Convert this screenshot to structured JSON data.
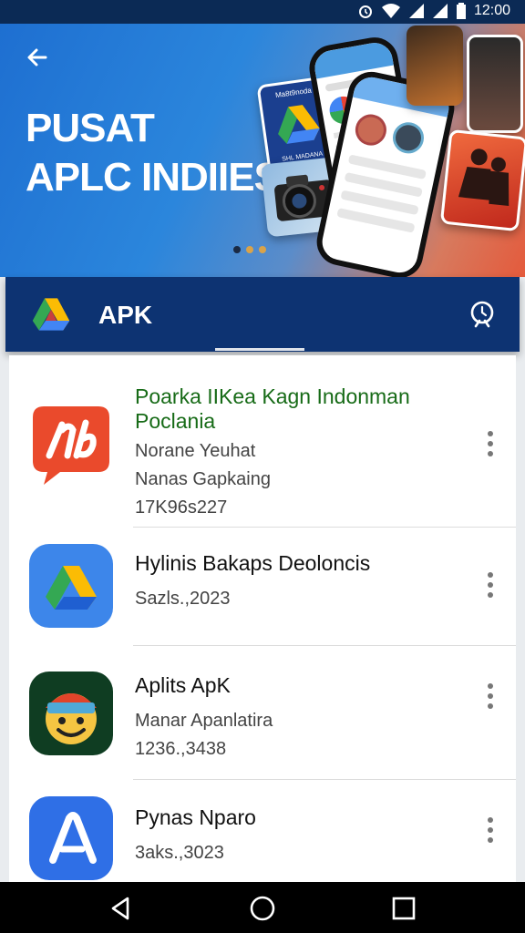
{
  "status_bar": {
    "time": "12:00"
  },
  "banner": {
    "title_line1": "PUSAT",
    "title_line2": "APLC INDIIESIA",
    "card_label": "Ma8t9noda",
    "card_sublabel": "SHL MADANA",
    "carousel_dots": 3,
    "carousel_active": 0
  },
  "appbar": {
    "title": "APK"
  },
  "apps": [
    {
      "name_line1": "Poarka IIKea Kagn Indonman",
      "name_line2": "Poclania",
      "detail1": "Norane Yeuhat",
      "detail2": "Nanas Gapkaing",
      "detail3": "17K96s227",
      "highlight": true
    },
    {
      "name_line1": "Hylinis Bakaps Deoloncis",
      "detail1": "Sazls.,2023"
    },
    {
      "name_line1": "Aplits ApK",
      "detail1": "Manar Apanlatira",
      "detail2": "1236.,3438"
    },
    {
      "name_line1": "Pynas Nparo",
      "detail1": "3aks.,3023"
    }
  ],
  "colors": {
    "status_bar": "#0b2a55",
    "appbar": "#0d3372",
    "highlight_text": "#176b17"
  }
}
